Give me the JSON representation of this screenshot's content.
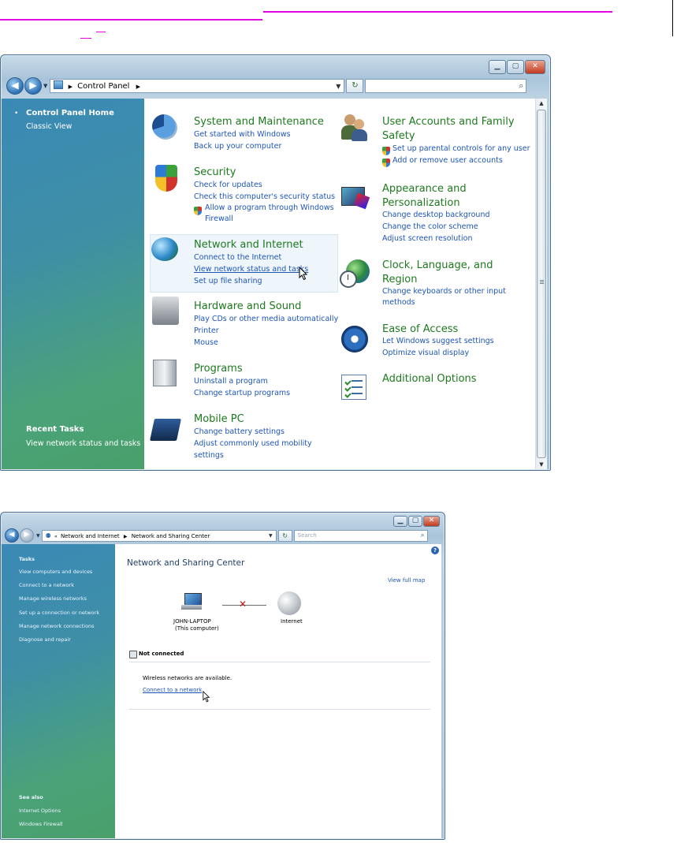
{
  "window1": {
    "address_path": "Control Panel",
    "sidebar": {
      "home": "Control Panel Home",
      "classic": "Classic View",
      "recent_title": "Recent Tasks",
      "recent_item": "View network status and tasks"
    },
    "left_categories": [
      {
        "title": "System and Maintenance",
        "icon": "system-maintenance-icon",
        "links": [
          "Get started with Windows",
          "Back up your computer"
        ]
      },
      {
        "title": "Security",
        "icon": "security-shield-icon",
        "links": [
          "Check for updates",
          "Check this computer's security status",
          "Allow a program through Windows",
          "Firewall"
        ]
      },
      {
        "title": "Network and Internet",
        "icon": "network-internet-icon",
        "links": [
          "Connect to the Internet",
          "View network status and tasks",
          "Set up file sharing"
        ]
      },
      {
        "title": "Hardware and Sound",
        "icon": "hardware-sound-icon",
        "links": [
          "Play CDs or other media automatically",
          "Printer",
          "Mouse"
        ]
      },
      {
        "title": "Programs",
        "icon": "programs-icon",
        "links": [
          "Uninstall a program",
          "Change startup programs"
        ]
      },
      {
        "title": "Mobile PC",
        "icon": "mobile-pc-icon",
        "links": [
          "Change battery settings",
          "Adjust commonly used mobility",
          "settings"
        ]
      }
    ],
    "right_categories": [
      {
        "title_lines": [
          "User Accounts and Family",
          "Safety"
        ],
        "icon": "user-accounts-icon",
        "links": [
          "Set up parental controls for any user",
          "Add or remove user accounts"
        ]
      },
      {
        "title_lines": [
          "Appearance and",
          "Personalization"
        ],
        "icon": "appearance-icon",
        "links": [
          "Change desktop background",
          "Change the color scheme",
          "Adjust screen resolution"
        ]
      },
      {
        "title_lines": [
          "Clock, Language, and",
          "Region"
        ],
        "icon": "clock-globe-icon",
        "links": [
          "Change keyboards or other input",
          "methods"
        ]
      },
      {
        "title_lines": [
          "Ease of Access"
        ],
        "icon": "ease-of-access-icon",
        "links": [
          "Let Windows suggest settings",
          "Optimize visual display"
        ]
      },
      {
        "title_lines": [
          "Additional Options"
        ],
        "icon": "additional-options-icon",
        "links": []
      }
    ]
  },
  "window2": {
    "address_path_1": "Network and Internet",
    "address_path_2": "Network and Sharing Center",
    "search_placeholder": "Search",
    "sidebar": {
      "tasks_title": "Tasks",
      "tasks": [
        "View computers and devices",
        "Connect to a network",
        "Manage wireless networks",
        "Set up a connection or network",
        "Manage network connections",
        "Diagnose and repair"
      ],
      "see_also_title": "See also",
      "see_also": [
        "Internet Options",
        "Windows Firewall"
      ]
    },
    "page_title": "Network and Sharing Center",
    "view_full_map": "View full map",
    "computer_name": "JOHN-LAPTOP",
    "computer_sub": "(This computer)",
    "internet_label": "Internet",
    "status": "Not connected",
    "wireless_msg": "Wireless networks are available.",
    "connect_link": "Connect to a network"
  },
  "colors": {
    "category_title": "#1e7a1e",
    "link": "#1d55b8",
    "sidebar_top": "#3a89b6",
    "sidebar_bottom": "#4aa06a",
    "close_button": "#c23b1f",
    "disconnect_x": "#d01818",
    "decor_line": "#e000e0"
  }
}
